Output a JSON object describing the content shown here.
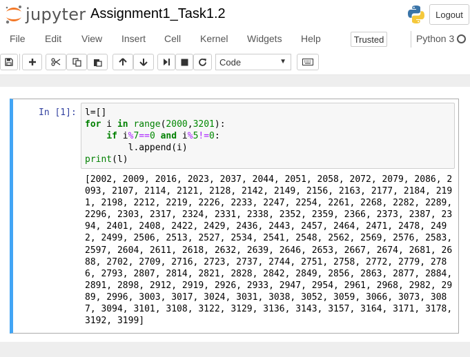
{
  "header": {
    "brand": "jupyter",
    "notebook_title": "Assignment1_Task1.2",
    "logout_label": "Logout"
  },
  "menu": {
    "items": [
      "File",
      "Edit",
      "View",
      "Insert",
      "Cell",
      "Kernel",
      "Widgets",
      "Help"
    ],
    "trusted_label": "Trusted",
    "kernel_name": "Python 3"
  },
  "toolbar": {
    "icons": [
      "save-icon",
      "plus-icon",
      "cut-icon",
      "copy-icon",
      "paste-icon",
      "arrow-up-icon",
      "arrow-down-icon",
      "step-forward-icon",
      "stop-icon",
      "refresh-icon",
      "keyboard-icon"
    ],
    "cell_type": "Code"
  },
  "cell": {
    "prompt": "In [1]:",
    "code_lines": [
      "l=[]",
      "for i in range(2000,3201):",
      "    if i%7==0 and i%5!=0:",
      "        l.append(i)",
      "print(l)"
    ],
    "output_lines": [
      "[2002, 2009, 2016, 2023, 2037, 2044, 2051, 2058, 2072, 2079, 2086, 2",
      "093, 2107, 2114, 2121, 2128, 2142, 2149, 2156, 2163, 2177, 2184, 219",
      "1, 2198, 2212, 2219, 2226, 2233, 2247, 2254, 2261, 2268, 2282, 2289,",
      "2296, 2303, 2317, 2324, 2331, 2338, 2352, 2359, 2366, 2373, 2387, 23",
      "94, 2401, 2408, 2422, 2429, 2436, 2443, 2457, 2464, 2471, 2478, 249",
      "2, 2499, 2506, 2513, 2527, 2534, 2541, 2548, 2562, 2569, 2576, 2583,",
      "2597, 2604, 2611, 2618, 2632, 2639, 2646, 2653, 2667, 2674, 2681, 26",
      "88, 2702, 2709, 2716, 2723, 2737, 2744, 2751, 2758, 2772, 2779, 278",
      "6, 2793, 2807, 2814, 2821, 2828, 2842, 2849, 2856, 2863, 2877, 2884,",
      "2891, 2898, 2912, 2919, 2926, 2933, 2947, 2954, 2961, 2968, 2982, 29",
      "89, 2996, 3003, 3017, 3024, 3031, 3038, 3052, 3059, 3066, 3073, 308",
      "7, 3094, 3101, 3108, 3122, 3129, 3136, 3143, 3157, 3164, 3171, 3178,",
      "3192, 3199]"
    ]
  },
  "colors": {
    "accent_cell_border": "#42a5f5",
    "prompt_color": "#303f9f",
    "keyword_color": "#008000",
    "operator_color": "#aa22ff",
    "jupyter_orange": "#f37726"
  }
}
